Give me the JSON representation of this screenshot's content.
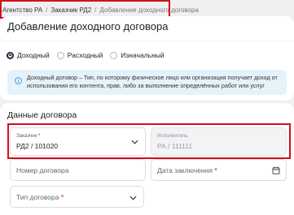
{
  "breadcrumb": {
    "items": [
      "Агентство РА",
      "Заказчик РД2",
      "Добавление доходного договора"
    ],
    "separator": "/"
  },
  "page_title": "Добавление доходного договора",
  "contract_type_radio": {
    "options": [
      {
        "label": "Доходный",
        "selected": true
      },
      {
        "label": "Расходный",
        "selected": false
      },
      {
        "label": "Изначальный",
        "selected": false
      }
    ]
  },
  "info": {
    "icon": "info-icon",
    "text": "Доходный договор – Тип, по которому физическое лицо или организация получает доход от использования его контента, прав, либо за выполнение определённых работ или услуг"
  },
  "section": {
    "title": "Данные договора"
  },
  "fields": {
    "customer": {
      "label": "Заказчик",
      "required_mark": "*",
      "value": "РД2 / 101020"
    },
    "executor": {
      "label": "Исполнитель",
      "value": "РА / 111111"
    },
    "contract_number": {
      "placeholder": "Номер договора"
    },
    "contract_date": {
      "placeholder": "Дата заключения",
      "required_mark": "*"
    },
    "contract_kind": {
      "placeholder": "Тип договора",
      "required_mark": "*"
    }
  },
  "colors": {
    "accent_dark": "#1f2a3a",
    "required": "#d20f1b",
    "highlight": "#d20f1b",
    "info_bg": "#e6f2fa",
    "info_icon": "#2f8fd0"
  }
}
